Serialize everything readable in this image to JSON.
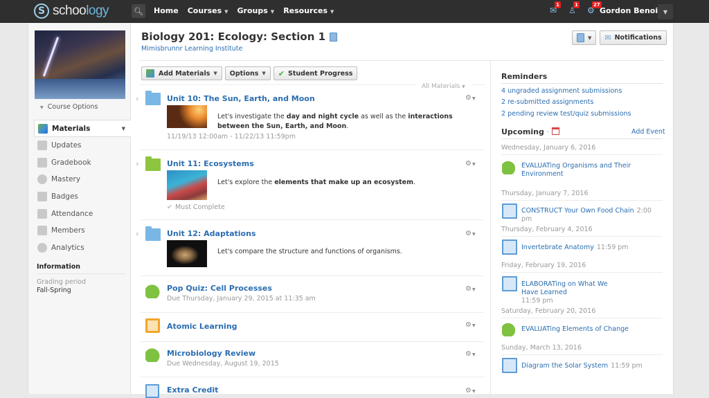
{
  "topbar": {
    "logo_prefix": "schoo",
    "logo_suffix": "logy",
    "nav": [
      {
        "label": "Home",
        "dropdown": false
      },
      {
        "label": "Courses",
        "dropdown": true
      },
      {
        "label": "Groups",
        "dropdown": true
      },
      {
        "label": "Resources",
        "dropdown": true
      }
    ],
    "notifications": [
      {
        "icon": "mail-icon",
        "count": "1"
      },
      {
        "icon": "requests-icon",
        "count": "1"
      },
      {
        "icon": "alerts-icon",
        "count": "27"
      }
    ],
    "user_name": "Gordon Benoit"
  },
  "sidebar": {
    "course_options": "Course Options",
    "items": [
      {
        "label": "Materials",
        "icon": "materials-icon",
        "active": true
      },
      {
        "label": "Updates",
        "icon": "updates-icon"
      },
      {
        "label": "Gradebook",
        "icon": "gradebook-icon"
      },
      {
        "label": "Mastery",
        "icon": "mastery-icon"
      },
      {
        "label": "Badges",
        "icon": "badges-icon"
      },
      {
        "label": "Attendance",
        "icon": "attendance-icon"
      },
      {
        "label": "Members",
        "icon": "members-icon"
      },
      {
        "label": "Analytics",
        "icon": "analytics-icon"
      }
    ],
    "info_heading": "Information",
    "grading_label": "Grading period",
    "grading_value": "Fall-Spring"
  },
  "header": {
    "title": "Biology 201: Ecology: Section 1",
    "school": "Mimisbrunnr Learning Institute",
    "notifications_button": "Notifications"
  },
  "toolbar": {
    "add_materials": "Add Materials",
    "options": "Options",
    "student_progress": "Student Progress",
    "filter": "All Materials"
  },
  "materials": [
    {
      "type": "folder",
      "title": "Unit 10: The Sun, Earth, and Moon",
      "desc_html_parts": [
        "Let's investigate the ",
        "day and night cycle",
        " as well as the ",
        "interactions between the Sun, Earth, and Moon",
        "."
      ],
      "meta": "11/19/13 12:00am - 11/22/13 11:59pm"
    },
    {
      "type": "folder",
      "title": "Unit 11: Ecosystems",
      "desc_html_parts": [
        "Let's explore the ",
        "elements that make up an ecosystem",
        "."
      ],
      "meta": "Must Complete"
    },
    {
      "type": "folder",
      "title": "Unit 12: Adaptations",
      "desc_html_parts": [
        "Let's compare the structure and functions of organisms."
      ]
    },
    {
      "type": "assessment",
      "title": "Pop Quiz: Cell Processes",
      "meta": "Due Thursday, January 29, 2015 at 11:35 am"
    },
    {
      "type": "external-tool",
      "title": "Atomic Learning"
    },
    {
      "type": "assessment",
      "title": "Microbiology Review",
      "meta": "Due Wednesday, August 19, 2015"
    },
    {
      "type": "assignment",
      "title": "Extra Credit"
    }
  ],
  "reminders": {
    "heading": "Reminders",
    "items": [
      "4 ungraded assignment submissions",
      "2 re-submitted assignments",
      "2 pending review test/quiz submissions"
    ]
  },
  "upcoming": {
    "heading": "Upcoming",
    "separator": "·",
    "add_event": "Add Event",
    "days": [
      {
        "date": "Wednesday, January 6, 2016",
        "event": "EVALUATing Organisms and Their Environment",
        "time": "",
        "type": "assessment"
      },
      {
        "date": "Thursday, January 7, 2016",
        "event": "CONSTRUCT Your Own Food Chain",
        "time": "2:00 pm",
        "type": "assignment"
      },
      {
        "date": "Thursday, February 4, 2016",
        "event": "Invertebrate Anatomy",
        "time": "11:59 pm",
        "type": "assignment"
      },
      {
        "date": "Friday, February 19, 2016",
        "event": "ELABORATing on What We Have Learned",
        "time": "11:59 pm",
        "type": "assignment"
      },
      {
        "date": "Saturday, February 20, 2016",
        "event": "EVALUATing Elements of Change",
        "time": "",
        "type": "assessment"
      },
      {
        "date": "Sunday, March 13, 2016",
        "event": "Diagram the Solar System",
        "time": "11:59 pm",
        "type": "assignment"
      }
    ]
  }
}
